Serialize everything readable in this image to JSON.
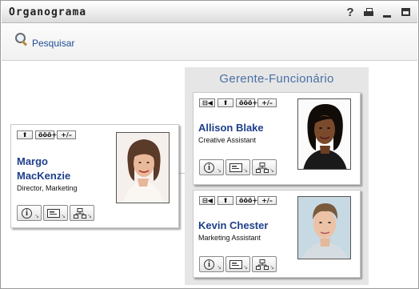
{
  "window": {
    "title": "Organograma",
    "help_glyph": "?"
  },
  "toolbar": {
    "search_label": "Pesquisar"
  },
  "group": {
    "title": "Gerente-Funcionário"
  },
  "buttons": {
    "up": "⬆",
    "org": "ööö+",
    "expand": "+/–",
    "back": "⊟◀"
  },
  "people": {
    "margo": {
      "name_line1": "Margo",
      "name_line2": "MacKenzie",
      "title": "Director, Marketing"
    },
    "allison": {
      "name": "Allison Blake",
      "title": "Creative Assistant"
    },
    "kevin": {
      "name": "Kevin Chester",
      "title": "Marketing Assistant"
    }
  },
  "icons": [
    "help-icon",
    "print-icon",
    "minimize-icon",
    "maximize-icon",
    "search-icon",
    "info-icon",
    "vcard-icon",
    "org-chart-icon"
  ],
  "colors": {
    "name_link": "#1e3f8a",
    "panel_title": "#4a6fa5",
    "panel_bg": "#e6e6e6"
  }
}
